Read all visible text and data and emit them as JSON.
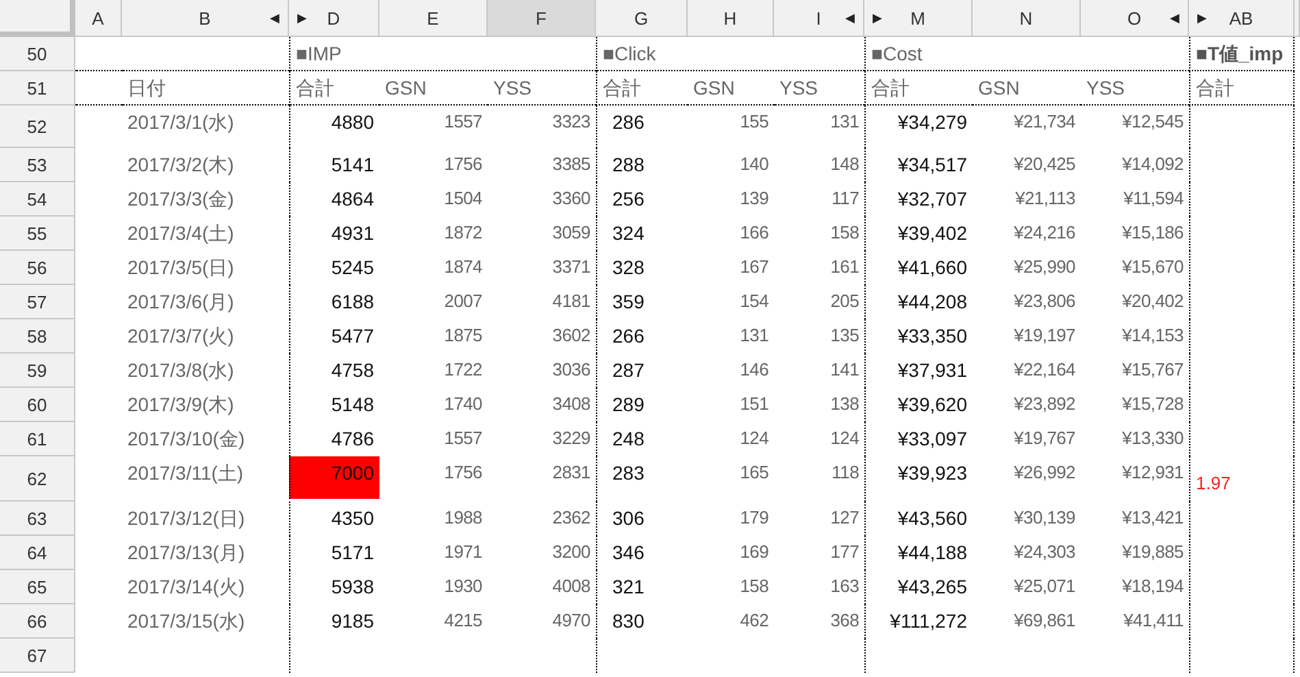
{
  "columns": [
    {
      "label": "A",
      "selected": false
    },
    {
      "label": "B",
      "selected": false,
      "collapse": "◀"
    },
    {
      "label": "D",
      "selected": false,
      "expand": "▶"
    },
    {
      "label": "E",
      "selected": false
    },
    {
      "label": "F",
      "selected": true
    },
    {
      "label": "G",
      "selected": false
    },
    {
      "label": "H",
      "selected": false
    },
    {
      "label": "I",
      "selected": false,
      "collapse": "◀"
    },
    {
      "label": "M",
      "selected": false,
      "expand": "▶"
    },
    {
      "label": "N",
      "selected": false
    },
    {
      "label": "O",
      "selected": false,
      "collapse": "◀"
    },
    {
      "label": "AB",
      "selected": false,
      "expand": "▶"
    }
  ],
  "section_row": {
    "number": "50",
    "sections": [
      {
        "title": "■IMP",
        "bold": false
      },
      {
        "title": "■Click",
        "bold": false
      },
      {
        "title": "■Cost",
        "bold": false
      },
      {
        "title": "■T値_imp",
        "bold": true
      }
    ]
  },
  "subheader_row": {
    "number": "51",
    "date_label": "日付",
    "labels": [
      [
        "合計",
        "GSN",
        "YSS"
      ],
      [
        "合計",
        "GSN",
        "YSS"
      ],
      [
        "合計",
        "GSN",
        "YSS"
      ],
      [
        "合計"
      ]
    ]
  },
  "rows": [
    {
      "number": "52",
      "date": "2017/3/1(水)",
      "values": [
        "4880",
        "1557",
        "3323",
        "286",
        "155",
        "131",
        "¥34,279",
        "¥21,734",
        "¥12,545"
      ],
      "imp_alert": false
    },
    {
      "number": "53",
      "date": "2017/3/2(木)",
      "values": [
        "5141",
        "1756",
        "3385",
        "288",
        "140",
        "148",
        "¥34,517",
        "¥20,425",
        "¥14,092"
      ],
      "imp_alert": false
    },
    {
      "number": "54",
      "date": "2017/3/3(金)",
      "values": [
        "4864",
        "1504",
        "3360",
        "256",
        "139",
        "117",
        "¥32,707",
        "¥21,113",
        "¥11,594"
      ],
      "imp_alert": false
    },
    {
      "number": "55",
      "date": "2017/3/4(土)",
      "values": [
        "4931",
        "1872",
        "3059",
        "324",
        "166",
        "158",
        "¥39,402",
        "¥24,216",
        "¥15,186"
      ],
      "imp_alert": false
    },
    {
      "number": "56",
      "date": "2017/3/5(日)",
      "values": [
        "5245",
        "1874",
        "3371",
        "328",
        "167",
        "161",
        "¥41,660",
        "¥25,990",
        "¥15,670"
      ],
      "imp_alert": false
    },
    {
      "number": "57",
      "date": "2017/3/6(月)",
      "values": [
        "6188",
        "2007",
        "4181",
        "359",
        "154",
        "205",
        "¥44,208",
        "¥23,806",
        "¥20,402"
      ],
      "imp_alert": false
    },
    {
      "number": "58",
      "date": "2017/3/7(火)",
      "values": [
        "5477",
        "1875",
        "3602",
        "266",
        "131",
        "135",
        "¥33,350",
        "¥19,197",
        "¥14,153"
      ],
      "imp_alert": false
    },
    {
      "number": "59",
      "date": "2017/3/8(水)",
      "values": [
        "4758",
        "1722",
        "3036",
        "287",
        "146",
        "141",
        "¥37,931",
        "¥22,164",
        "¥15,767"
      ],
      "imp_alert": false
    },
    {
      "number": "60",
      "date": "2017/3/9(木)",
      "values": [
        "5148",
        "1740",
        "3408",
        "289",
        "151",
        "138",
        "¥39,620",
        "¥23,892",
        "¥15,728"
      ],
      "imp_alert": false
    },
    {
      "number": "61",
      "date": "2017/3/10(金)",
      "values": [
        "4786",
        "1557",
        "3229",
        "248",
        "124",
        "124",
        "¥33,097",
        "¥19,767",
        "¥13,330"
      ],
      "imp_alert": false
    },
    {
      "number": "62",
      "date": "2017/3/11(土)",
      "values": [
        "7000",
        "1756",
        "2831",
        "283",
        "165",
        "118",
        "¥39,923",
        "¥26,992",
        "¥12,931"
      ],
      "imp_alert": true,
      "t_value": "1.97"
    },
    {
      "number": "63",
      "date": "2017/3/12(日)",
      "values": [
        "4350",
        "1988",
        "2362",
        "306",
        "179",
        "127",
        "¥43,560",
        "¥30,139",
        "¥13,421"
      ],
      "imp_alert": false
    },
    {
      "number": "64",
      "date": "2017/3/13(月)",
      "values": [
        "5171",
        "1971",
        "3200",
        "346",
        "169",
        "177",
        "¥44,188",
        "¥24,303",
        "¥19,885"
      ],
      "imp_alert": false
    },
    {
      "number": "65",
      "date": "2017/3/14(火)",
      "values": [
        "5938",
        "1930",
        "4008",
        "321",
        "158",
        "163",
        "¥43,265",
        "¥25,071",
        "¥18,194"
      ],
      "imp_alert": false
    },
    {
      "number": "66",
      "date": "2017/3/15(水)",
      "values": [
        "9185",
        "4215",
        "4970",
        "830",
        "462",
        "368",
        "¥111,272",
        "¥69,861",
        "¥41,411"
      ],
      "imp_alert": false
    }
  ],
  "empty_rows": [
    "67"
  ]
}
